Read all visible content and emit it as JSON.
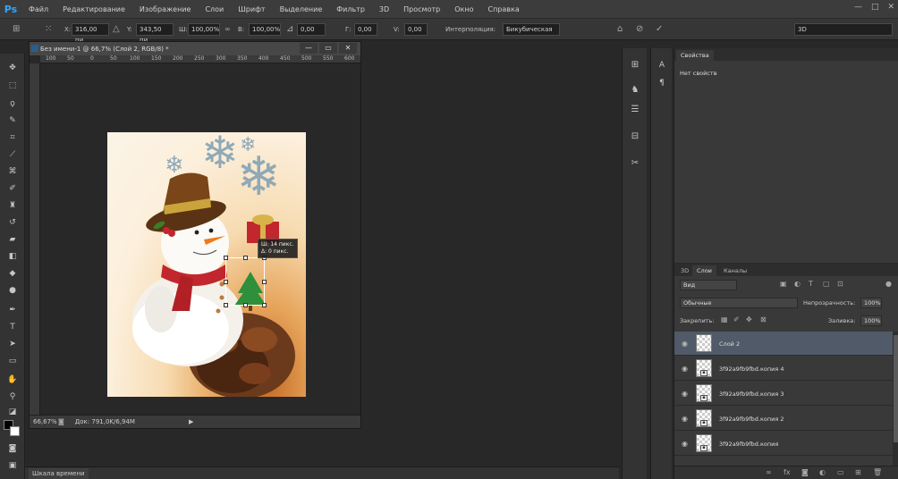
{
  "menu": {
    "logo": "Ps",
    "items": [
      "Файл",
      "Редактирование",
      "Изображение",
      "Слои",
      "Шрифт",
      "Выделение",
      "Фильтр",
      "3D",
      "Просмотр",
      "Окно",
      "Справка"
    ],
    "window_controls": [
      "—",
      "□",
      "✕"
    ]
  },
  "options": {
    "x_label": "X:",
    "x_value": "316,00 пи",
    "y_label": "Y:",
    "y_value": "343,50 пи",
    "w_label": "Ш:",
    "w_value": "100,00%",
    "h_label": "В:",
    "h_value": "100,00%",
    "angle_value": "0,00",
    "hskew_label": "Г:",
    "hskew_value": "0,00",
    "vskew_label": "V:",
    "vskew_value": "0,00",
    "interp_label": "Интерполяция:",
    "interp_value": "Бикубическая",
    "workspace_value": "3D"
  },
  "document": {
    "title": "Без имени-1 @ 66,7% (Слой 2, RGB/8) *",
    "zoom": "66,67%",
    "doc_info": "Док: 791,0K/6,94M",
    "ruler_numbers": [
      "100",
      "50",
      "0",
      "50",
      "100",
      "150",
      "200",
      "250",
      "300",
      "350",
      "400",
      "450",
      "500",
      "550",
      "600"
    ],
    "tooltip_line1": "Ш: 14 пикс.",
    "tooltip_line2": "Δ: 0 пикс."
  },
  "timeline": {
    "label": "Шкала времени"
  },
  "properties_panel": {
    "tab": "Свойства",
    "empty_text": "Нет свойств"
  },
  "layers_panel": {
    "tabs": [
      "3D",
      "Слои",
      "Каналы"
    ],
    "filter_value": "Вид",
    "blend_mode": "Обычные",
    "opacity_label": "Непрозрачность:",
    "opacity_value": "100%",
    "lock_label": "Закрепить:",
    "fill_label": "Заливка:",
    "fill_value": "100%",
    "layers": [
      {
        "name": "Слой 2",
        "selected": true,
        "smart": false
      },
      {
        "name": "3f92a9fb9fbd.копия 4",
        "selected": false,
        "smart": true
      },
      {
        "name": "3f92a9fb9fbd.копия 3",
        "selected": false,
        "smart": true
      },
      {
        "name": "3f92a9fb9fbd.копия 2",
        "selected": false,
        "smart": true
      },
      {
        "name": "3f92a9fb9fbd.копия",
        "selected": false,
        "smart": true
      }
    ]
  }
}
